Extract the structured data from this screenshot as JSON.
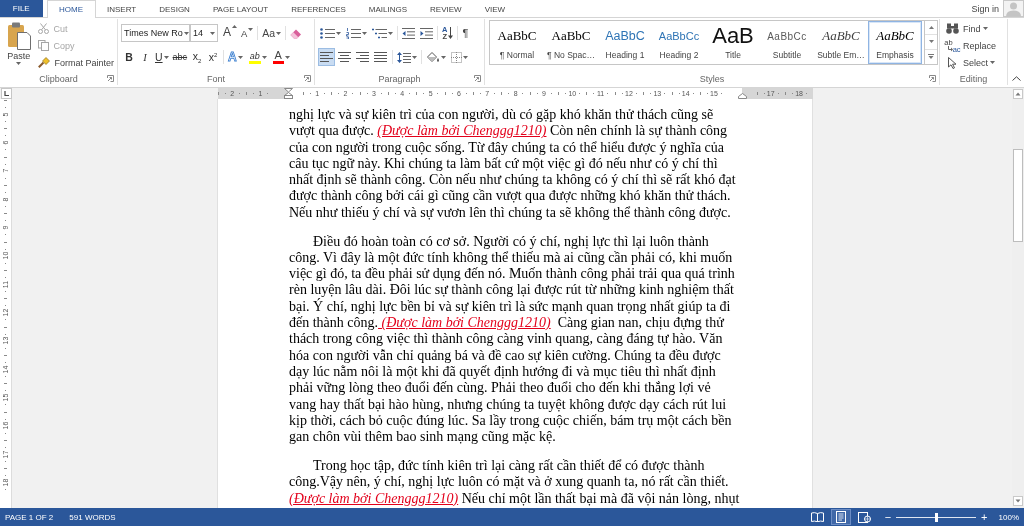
{
  "tabs": [
    {
      "label": "FILE",
      "kind": "backstage",
      "selected": false
    },
    {
      "label": "HOME",
      "kind": "tab",
      "selected": true
    },
    {
      "label": "INSERT",
      "kind": "tab",
      "selected": false
    },
    {
      "label": "DESIGN",
      "kind": "tab",
      "selected": false
    },
    {
      "label": "PAGE LAYOUT",
      "kind": "tab",
      "selected": false
    },
    {
      "label": "REFERENCES",
      "kind": "tab",
      "selected": false
    },
    {
      "label": "MAILINGS",
      "kind": "tab",
      "selected": false
    },
    {
      "label": "REVIEW",
      "kind": "tab",
      "selected": false
    },
    {
      "label": "VIEW",
      "kind": "tab",
      "selected": false
    }
  ],
  "account": {
    "label": "Sign in"
  },
  "clipboard": {
    "label": "Clipboard",
    "paste": "Paste",
    "commands": [
      {
        "label": "Cut",
        "disabled": true
      },
      {
        "label": "Copy",
        "disabled": true
      },
      {
        "label": "Format Painter",
        "disabled": false
      }
    ]
  },
  "font": {
    "label": "Font",
    "font_name": "Times New Ro",
    "font_size": "14",
    "grow": "A",
    "shrink": "A",
    "change_case": "Aa",
    "formats": [
      {
        "glyph": "B",
        "kind": "bold",
        "dropdown": false
      },
      {
        "glyph": "I",
        "kind": "italic",
        "dropdown": false
      },
      {
        "glyph": "U",
        "kind": "underline",
        "dropdown": true
      },
      {
        "glyph": "abc",
        "kind": "strikethrough",
        "dropdown": false
      },
      {
        "glyph": "x$_{2}$",
        "kind": "subscript",
        "dropdown": false
      },
      {
        "glyph": "x$^{2}$",
        "kind": "superscript",
        "dropdown": false
      }
    ],
    "text_effects": "A",
    "highlight": {
      "glyph": "ab",
      "color": "#ffff00"
    },
    "font_color": {
      "glyph": "A",
      "color": "#ff0000"
    }
  },
  "paragraph": {
    "label": "Paragraph",
    "sort": [
      "A",
      "Z"
    ],
    "pilcrow": "¶",
    "alignments": [
      {
        "kind": "left",
        "selected": true
      },
      {
        "kind": "center",
        "selected": false
      },
      {
        "kind": "right",
        "selected": false
      },
      {
        "kind": "justify",
        "selected": false
      }
    ]
  },
  "styles": {
    "label": "Styles",
    "items": [
      {
        "preview": "AaBbC",
        "name": "¶ Normal",
        "kind": "normal",
        "selected": false
      },
      {
        "preview": "AaBbC",
        "name": "¶ No Spac…",
        "kind": "no_spacing",
        "selected": false
      },
      {
        "preview": "AaBbC",
        "name": "Heading 1",
        "kind": "heading1",
        "selected": false
      },
      {
        "preview": "AaBbCc",
        "name": "Heading 2",
        "kind": "heading2",
        "selected": false
      },
      {
        "preview": "AaB",
        "name": "Title",
        "kind": "title",
        "selected": false
      },
      {
        "preview": "AaBbCc",
        "name": "Subtitle",
        "kind": "subtitle",
        "selected": false
      },
      {
        "preview": "AaBbC",
        "name": "Subtle Em…",
        "kind": "subtle_emphasis",
        "selected": false
      },
      {
        "preview": "AaBbC",
        "name": "Emphasis",
        "kind": "emphasis",
        "selected": true
      }
    ]
  },
  "editing": {
    "label": "Editing",
    "commands": [
      {
        "label": "Find",
        "kind": "find",
        "dropdown": true
      },
      {
        "label": "Replace",
        "kind": "replace",
        "dropdown": false,
        "glyphs": [
          "ab",
          "ac"
        ]
      },
      {
        "label": "Select",
        "kind": "select",
        "dropdown": true
      }
    ]
  },
  "ruler": {
    "left_numbers": [
      "2",
      "1"
    ],
    "numbers": [
      "1",
      "2",
      "3",
      "4",
      "5",
      "6",
      "7",
      "8",
      "9",
      "10",
      "11",
      "12",
      "13",
      "14",
      "15"
    ],
    "right_numbers": [
      "17",
      "18"
    ]
  },
  "vertical_ruler": {
    "numbers": [
      "5",
      "6",
      "7",
      "8",
      "9",
      "10",
      "11",
      "12",
      "13",
      "14",
      "15",
      "16",
      "17",
      "18"
    ]
  },
  "document": {
    "paragraphs": [
      {
        "indented": false,
        "lines": [
          [
            "nghị lực và sự kiên trì của con người, dù có gặp khó khăn thử thách cũng sẽ"
          ],
          [
            "vượt qua được. ",
            {
              "kind": "link",
              "text": "(Được làm bởi Chenggg1210)"
            },
            " Còn nên chính là sự thành công"
          ],
          [
            "của con người trong cuộc sống. Từ đây chúng ta có thể hiểu được ý nghĩa của"
          ],
          [
            "câu tục ngữ này. Khi chúng ta làm bất cứ một việc gì đó nếu như có ý chí thì"
          ],
          [
            "nhất định sẽ thành công. Còn nếu như chúng ta không có ý chí thì sẽ rất khó đạt"
          ],
          [
            "được thành công bởi cái gì cũng cần vượt qua được những khó khăn thử thách."
          ],
          [
            "Nếu như thiếu ý chí và sự vươn lên thì chúng ta sẽ không thể thành công được."
          ]
        ]
      },
      {
        "indented": true,
        "lines": [
          [
            "Điều đó hoàn toàn có cơ sở. Người có ý chí, nghị lực thì lại luôn thành"
          ],
          [
            "công. Vì đây là một đức tính không thể thiếu mà ai cũng cần phải có, khi muốn"
          ],
          [
            "việc gì đó, ta đều phải sử dụng đến nó. Muốn thành công phải trải qua quá trình"
          ],
          [
            "rèn luyện lâu dài. Đôi lúc sự thành công lại được rút từ những kinh nghiệm thất"
          ],
          [
            "bại. Ý chí, nghị lực bền bỉ và sự kiên trì là sức mạnh quan trọng nhất giúp ta đi"
          ],
          [
            "đến thành công.",
            {
              "kind": "link",
              "text": " (Được làm bởi Chenggg1210)"
            },
            "  Càng gian nan, chịu đựng thử"
          ],
          [
            "thách trong công việc thì thành công càng vinh quang, càng đáng tự hào. Văn"
          ],
          [
            "hóa con người vẫn chỉ quảng bá và đề cao sự kiên cường. Chúng ta đều được"
          ],
          [
            "dạy lúc nằm nôi là một khi đã quyết định hướng đi và mục tiêu thì nhất định"
          ],
          [
            "phải vững lòng theo đuổi đến cùng. Phải theo đuổi cho đến khi thắng lợi vẻ"
          ],
          [
            "vang hay thất bại hào hùng, nhưng chúng ta tuyệt không được dạy cách rút lui"
          ],
          [
            "kịp thời, cách bỏ cuộc đúng lúc. Sa lầy trong cuộc chiến, bám trụ một cách bền"
          ],
          [
            "gan chôn vùi thêm bao sinh mạng cũng mặc kệ."
          ]
        ]
      },
      {
        "indented": true,
        "lines": [
          [
            "Trong học tập, đức tính kiên trì lại càng rất cần thiết để có được thành"
          ],
          [
            "công.Vậy nên, ý chí, nghị lực luôn có mặt và ở xung quanh ta, nó rất cần thiết."
          ],
          [
            {
              "kind": "link",
              "text": "(Được làm bởi Chenggg1210)"
            },
            " Nếu chỉ một lần thất bại mà đã vội nản lòng, nhụt"
          ]
        ]
      }
    ]
  },
  "status_bar": {
    "page": "PAGE 1 OF 2",
    "words": "591 WORDS",
    "views": [
      {
        "kind": "read",
        "selected": false
      },
      {
        "kind": "print",
        "selected": true
      },
      {
        "kind": "web",
        "selected": false
      }
    ],
    "zoom_out": "−",
    "zoom_in": "+",
    "zoom": {
      "level": 0.5
    },
    "zoom_label": "100%"
  }
}
